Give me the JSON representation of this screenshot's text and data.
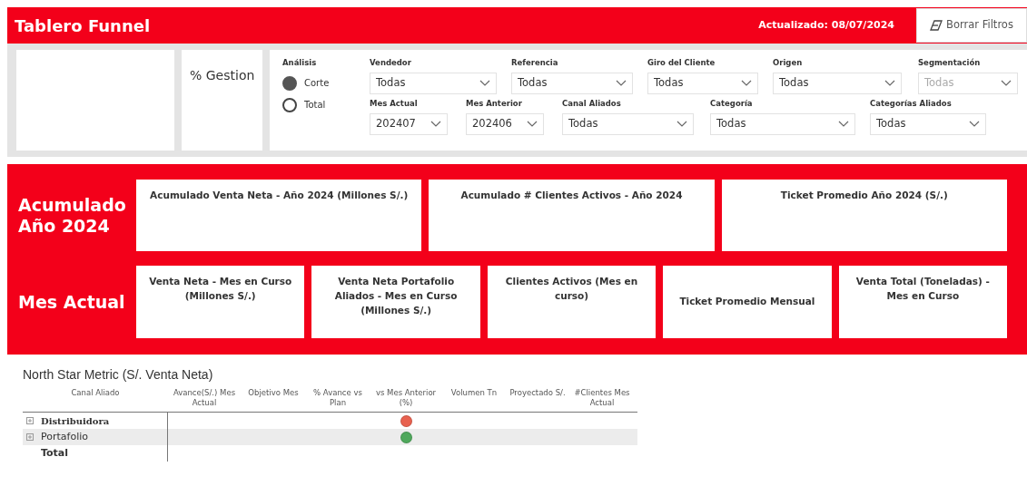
{
  "header": {
    "title": "Tablero Funnel",
    "updated": "Actualizado: 08/07/2024",
    "clear_button": "Borrar Filtros"
  },
  "filters": {
    "gestion_label": "% Gestion",
    "analysis": {
      "label": "Análisis",
      "options": [
        {
          "label": "Corte",
          "selected": true
        },
        {
          "label": "Total",
          "selected": false
        }
      ]
    },
    "rows": [
      [
        {
          "label": "Vendedor",
          "value": "Todas",
          "disabled": false
        },
        {
          "label": "Referencia",
          "value": "Todas",
          "disabled": false
        },
        {
          "label": "Giro del Cliente",
          "value": "Todas",
          "disabled": false
        },
        {
          "label": "Origen",
          "value": "Todas",
          "disabled": false
        },
        {
          "label": "Segmentación",
          "value": "Todas",
          "disabled": true
        }
      ],
      [
        {
          "label": "Mes Actual",
          "value": "202407",
          "disabled": false
        },
        {
          "label": "Mes Anterior",
          "value": "202406",
          "disabled": false
        },
        {
          "label": "Canal Aliados",
          "value": "Todas",
          "disabled": false
        },
        {
          "label": "Categoría",
          "value": "Todas",
          "disabled": false
        },
        {
          "label": "Categorías Aliados",
          "value": "Todas",
          "disabled": false
        }
      ]
    ]
  },
  "kpi_sections": [
    {
      "title": "Acumulado Año 2024",
      "cards": [
        "Acumulado Venta Neta - Año 2024 (Millones S/.)",
        "Acumulado # Clientes Activos - Año 2024",
        "Ticket Promedio Año 2024 (S/.)"
      ]
    },
    {
      "title": "Mes Actual",
      "cards": [
        "Venta Neta - Mes en Curso (Millones S/.)",
        "Venta Neta Portafolio Aliados - Mes en Curso (Millones S/.)",
        "Clientes Activos (Mes en curso)",
        "Ticket Promedio Mensual",
        "Venta Total (Toneladas) - Mes en Curso"
      ]
    }
  ],
  "table": {
    "title": "North Star Metric (S/. Venta Neta)",
    "columns": [
      "Canal Aliado",
      "Avance(S/.) Mes Actual",
      "Objetivo Mes",
      "% Avance vs Plan",
      "vs Mes Anterior (%)",
      "Volumen Tn",
      "Proyectado S/.",
      "#Clientes Mes Actual"
    ],
    "rows": [
      {
        "label": "Distribuidora",
        "expandable": true,
        "color": "#e8614f"
      },
      {
        "label": "Portafolio",
        "expandable": true,
        "color": "#4fa85c"
      }
    ],
    "total": "Total"
  }
}
